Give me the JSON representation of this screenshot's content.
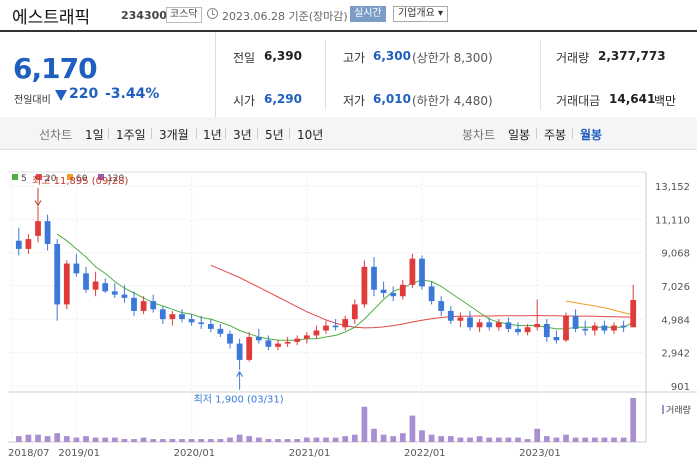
{
  "header": {
    "name": "에스트래픽",
    "code": "234300",
    "market": "코스닥",
    "date": "2023.06.28 기준(장마감)",
    "realtime": "실시간",
    "company_info": "기업개요 ▾"
  },
  "price": {
    "current": "6,170",
    "change_label": "전일대비",
    "change": "220",
    "change_pct": "-3.44%",
    "direction": "down"
  },
  "stats": {
    "prev_close_label": "전일",
    "prev_close": "6,390",
    "high_label": "고가",
    "high": "6,300",
    "upper_limit": "(상한가 8,300)",
    "volume_label": "거래량",
    "volume": "2,377,773",
    "open_label": "시가",
    "open": "6,290",
    "low_label": "저가",
    "low": "6,010",
    "lower_limit": "(하한가 4,480)",
    "amount_label": "거래대금",
    "amount": "14,641",
    "amount_unit": "백만"
  },
  "colors": {
    "up": "#e03a3a",
    "down": "#3b78d8",
    "accent": "#1f5fbf",
    "ma5": "#4caf3f",
    "ma20": "#e04a4a",
    "ma60": "#f39c2a",
    "ma120": "#9b59b6",
    "volume": "#a98fd0"
  },
  "tabs": {
    "line_label": "선차트",
    "line": [
      "1일",
      "1주일",
      "3개월",
      "1년",
      "3년",
      "5년",
      "10년"
    ],
    "candle_label": "봉차트",
    "candle": [
      "일봉",
      "주봉",
      "월봉"
    ],
    "active": "월봉"
  },
  "chart_data": {
    "type": "candlestick",
    "legend": [
      "5",
      "20",
      "60",
      "120"
    ],
    "y_ticks": [
      13152,
      11110,
      9068,
      7026,
      4984,
      2942,
      901
    ],
    "y_ticks_text": [
      "13,152",
      "11,110",
      "9,068",
      "7,026",
      "4,984",
      "2,942",
      "901"
    ],
    "x_ticks": [
      "2018/07",
      "2019/01",
      "2020/01",
      "2021/01",
      "2022/01",
      "2023/01"
    ],
    "ylim": [
      901,
      13152
    ],
    "annotation_high": "최고 11,895 (09/28)",
    "annotation_low": "최저 1,900 (03/31)",
    "volume_label": "거래량",
    "candles": [
      {
        "o": 9800,
        "h": 10600,
        "l": 8900,
        "c": 9300
      },
      {
        "o": 9300,
        "h": 10200,
        "l": 9000,
        "c": 9900
      },
      {
        "o": 10100,
        "h": 11895,
        "l": 9700,
        "c": 11000
      },
      {
        "o": 11000,
        "h": 11400,
        "l": 9200,
        "c": 9600
      },
      {
        "o": 9600,
        "h": 9900,
        "l": 4900,
        "c": 5900
      },
      {
        "o": 5900,
        "h": 8600,
        "l": 5600,
        "c": 8400
      },
      {
        "o": 8400,
        "h": 9000,
        "l": 7600,
        "c": 7800
      },
      {
        "o": 7800,
        "h": 8200,
        "l": 6600,
        "c": 6800
      },
      {
        "o": 6800,
        "h": 7900,
        "l": 6400,
        "c": 7300
      },
      {
        "o": 7200,
        "h": 7500,
        "l": 6600,
        "c": 6700
      },
      {
        "o": 6700,
        "h": 7200,
        "l": 6300,
        "c": 6500
      },
      {
        "o": 6500,
        "h": 7100,
        "l": 6000,
        "c": 6300
      },
      {
        "o": 6300,
        "h": 6700,
        "l": 5200,
        "c": 5500
      },
      {
        "o": 5500,
        "h": 6400,
        "l": 5300,
        "c": 6100
      },
      {
        "o": 6100,
        "h": 6500,
        "l": 5400,
        "c": 5600
      },
      {
        "o": 5600,
        "h": 5800,
        "l": 4700,
        "c": 5000
      },
      {
        "o": 5000,
        "h": 5500,
        "l": 4600,
        "c": 5300
      },
      {
        "o": 5300,
        "h": 5600,
        "l": 4800,
        "c": 5000
      },
      {
        "o": 5000,
        "h": 5300,
        "l": 4600,
        "c": 4800
      },
      {
        "o": 4800,
        "h": 5200,
        "l": 4400,
        "c": 4700
      },
      {
        "o": 4700,
        "h": 5000,
        "l": 4200,
        "c": 4400
      },
      {
        "o": 4400,
        "h": 4700,
        "l": 3900,
        "c": 4100
      },
      {
        "o": 4100,
        "h": 4300,
        "l": 3200,
        "c": 3500
      },
      {
        "o": 3500,
        "h": 3800,
        "l": 1900,
        "c": 2500
      },
      {
        "o": 2500,
        "h": 4200,
        "l": 2400,
        "c": 3900
      },
      {
        "o": 3900,
        "h": 4400,
        "l": 3500,
        "c": 3700
      },
      {
        "o": 3700,
        "h": 4000,
        "l": 3100,
        "c": 3300
      },
      {
        "o": 3300,
        "h": 3700,
        "l": 3100,
        "c": 3500
      },
      {
        "o": 3500,
        "h": 3900,
        "l": 3300,
        "c": 3600
      },
      {
        "o": 3600,
        "h": 4000,
        "l": 3400,
        "c": 3800
      },
      {
        "o": 3800,
        "h": 4200,
        "l": 3500,
        "c": 4000
      },
      {
        "o": 4000,
        "h": 4600,
        "l": 3800,
        "c": 4300
      },
      {
        "o": 4300,
        "h": 4900,
        "l": 4100,
        "c": 4600
      },
      {
        "o": 4600,
        "h": 5000,
        "l": 4300,
        "c": 4500
      },
      {
        "o": 4500,
        "h": 5200,
        "l": 4300,
        "c": 5000
      },
      {
        "o": 5000,
        "h": 6200,
        "l": 4700,
        "c": 5900
      },
      {
        "o": 5900,
        "h": 8600,
        "l": 5700,
        "c": 8200
      },
      {
        "o": 8200,
        "h": 8800,
        "l": 6400,
        "c": 6800
      },
      {
        "o": 6800,
        "h": 7300,
        "l": 6300,
        "c": 6600
      },
      {
        "o": 6600,
        "h": 7000,
        "l": 6100,
        "c": 6400
      },
      {
        "o": 6400,
        "h": 7400,
        "l": 6200,
        "c": 7100
      },
      {
        "o": 7100,
        "h": 9000,
        "l": 6900,
        "c": 8700
      },
      {
        "o": 8700,
        "h": 8900,
        "l": 6800,
        "c": 7000
      },
      {
        "o": 7000,
        "h": 7300,
        "l": 5900,
        "c": 6100
      },
      {
        "o": 6100,
        "h": 6400,
        "l": 5200,
        "c": 5500
      },
      {
        "o": 5500,
        "h": 5800,
        "l": 4700,
        "c": 4900
      },
      {
        "o": 4900,
        "h": 5400,
        "l": 4500,
        "c": 5100
      },
      {
        "o": 5100,
        "h": 5500,
        "l": 4300,
        "c": 4500
      },
      {
        "o": 4500,
        "h": 5000,
        "l": 4200,
        "c": 4800
      },
      {
        "o": 4800,
        "h": 5100,
        "l": 4300,
        "c": 4500
      },
      {
        "o": 4500,
        "h": 5000,
        "l": 4300,
        "c": 4800
      },
      {
        "o": 4800,
        "h": 5100,
        "l": 4200,
        "c": 4400
      },
      {
        "o": 4400,
        "h": 4800,
        "l": 4000,
        "c": 4200
      },
      {
        "o": 4200,
        "h": 4700,
        "l": 4000,
        "c": 4500
      },
      {
        "o": 4500,
        "h": 6200,
        "l": 4300,
        "c": 4700
      },
      {
        "o": 4700,
        "h": 5000,
        "l": 3600,
        "c": 3900
      },
      {
        "o": 3900,
        "h": 4300,
        "l": 3500,
        "c": 3700
      },
      {
        "o": 3700,
        "h": 5400,
        "l": 3600,
        "c": 5200
      },
      {
        "o": 5200,
        "h": 5600,
        "l": 4200,
        "c": 4400
      },
      {
        "o": 4400,
        "h": 4900,
        "l": 4000,
        "c": 4300
      },
      {
        "o": 4300,
        "h": 4800,
        "l": 4000,
        "c": 4600
      },
      {
        "o": 4600,
        "h": 4900,
        "l": 4100,
        "c": 4300
      },
      {
        "o": 4300,
        "h": 4800,
        "l": 4100,
        "c": 4600
      },
      {
        "o": 4600,
        "h": 4900,
        "l": 4200,
        "c": 4500
      },
      {
        "o": 4500,
        "h": 7100,
        "l": 4500,
        "c": 6170
      }
    ],
    "ma20": [
      null,
      null,
      null,
      null,
      null,
      null,
      null,
      null,
      null,
      null,
      null,
      null,
      null,
      null,
      null,
      null,
      null,
      null,
      null,
      null,
      8300,
      8050,
      7800,
      7550,
      7250,
      6950,
      6650,
      6350,
      6050,
      5750,
      5450,
      5200,
      4950,
      4750,
      4600,
      4500,
      4460,
      4480,
      4520,
      4600,
      4700,
      4820,
      4930,
      5020,
      5100,
      5140,
      5170,
      5180,
      5190,
      5190,
      5200,
      5200,
      5200,
      5210,
      5220,
      5210,
      5200,
      5190,
      5180,
      5180,
      5170,
      5150,
      5140,
      5130,
      5120
    ],
    "ma5": [
      null,
      null,
      null,
      null,
      10200,
      9800,
      9300,
      8800,
      8200,
      7800,
      7300,
      6900,
      6600,
      6300,
      6000,
      5800,
      5600,
      5400,
      5300,
      5100,
      5000,
      4800,
      4600,
      4300,
      4100,
      3900,
      3800,
      3700,
      3700,
      3700,
      3800,
      3800,
      3900,
      4000,
      4200,
      4500,
      5000,
      5600,
      6200,
      6700,
      6900,
      7200,
      7400,
      7300,
      7000,
      6600,
      6200,
      5800,
      5400,
      5000,
      4800,
      4700,
      4600,
      4600,
      4600,
      4500,
      4400,
      4400,
      4500,
      4500,
      4500,
      4500,
      4500,
      4500,
      4800
    ],
    "ma60": [
      null,
      null,
      null,
      null,
      null,
      null,
      null,
      null,
      null,
      null,
      null,
      null,
      null,
      null,
      null,
      null,
      null,
      null,
      null,
      null,
      null,
      null,
      null,
      null,
      null,
      null,
      null,
      null,
      null,
      null,
      null,
      null,
      null,
      null,
      null,
      null,
      null,
      null,
      null,
      null,
      null,
      null,
      null,
      null,
      null,
      null,
      null,
      null,
      null,
      null,
      null,
      null,
      null,
      null,
      null,
      null,
      null,
      6100,
      6000,
      5900,
      5800,
      5700,
      5550,
      5400,
      5250
    ],
    "volumes": [
      4,
      5,
      5,
      4,
      6,
      4,
      3,
      4,
      3,
      3,
      3,
      2,
      2,
      3,
      2,
      2,
      2,
      2,
      2,
      2,
      2,
      2,
      3,
      5,
      4,
      3,
      2,
      2,
      2,
      2,
      3,
      3,
      3,
      3,
      4,
      5,
      24,
      9,
      5,
      4,
      6,
      18,
      8,
      5,
      4,
      4,
      3,
      3,
      4,
      3,
      3,
      3,
      3,
      2,
      9,
      4,
      3,
      5,
      3,
      3,
      3,
      3,
      3,
      3,
      30
    ]
  }
}
